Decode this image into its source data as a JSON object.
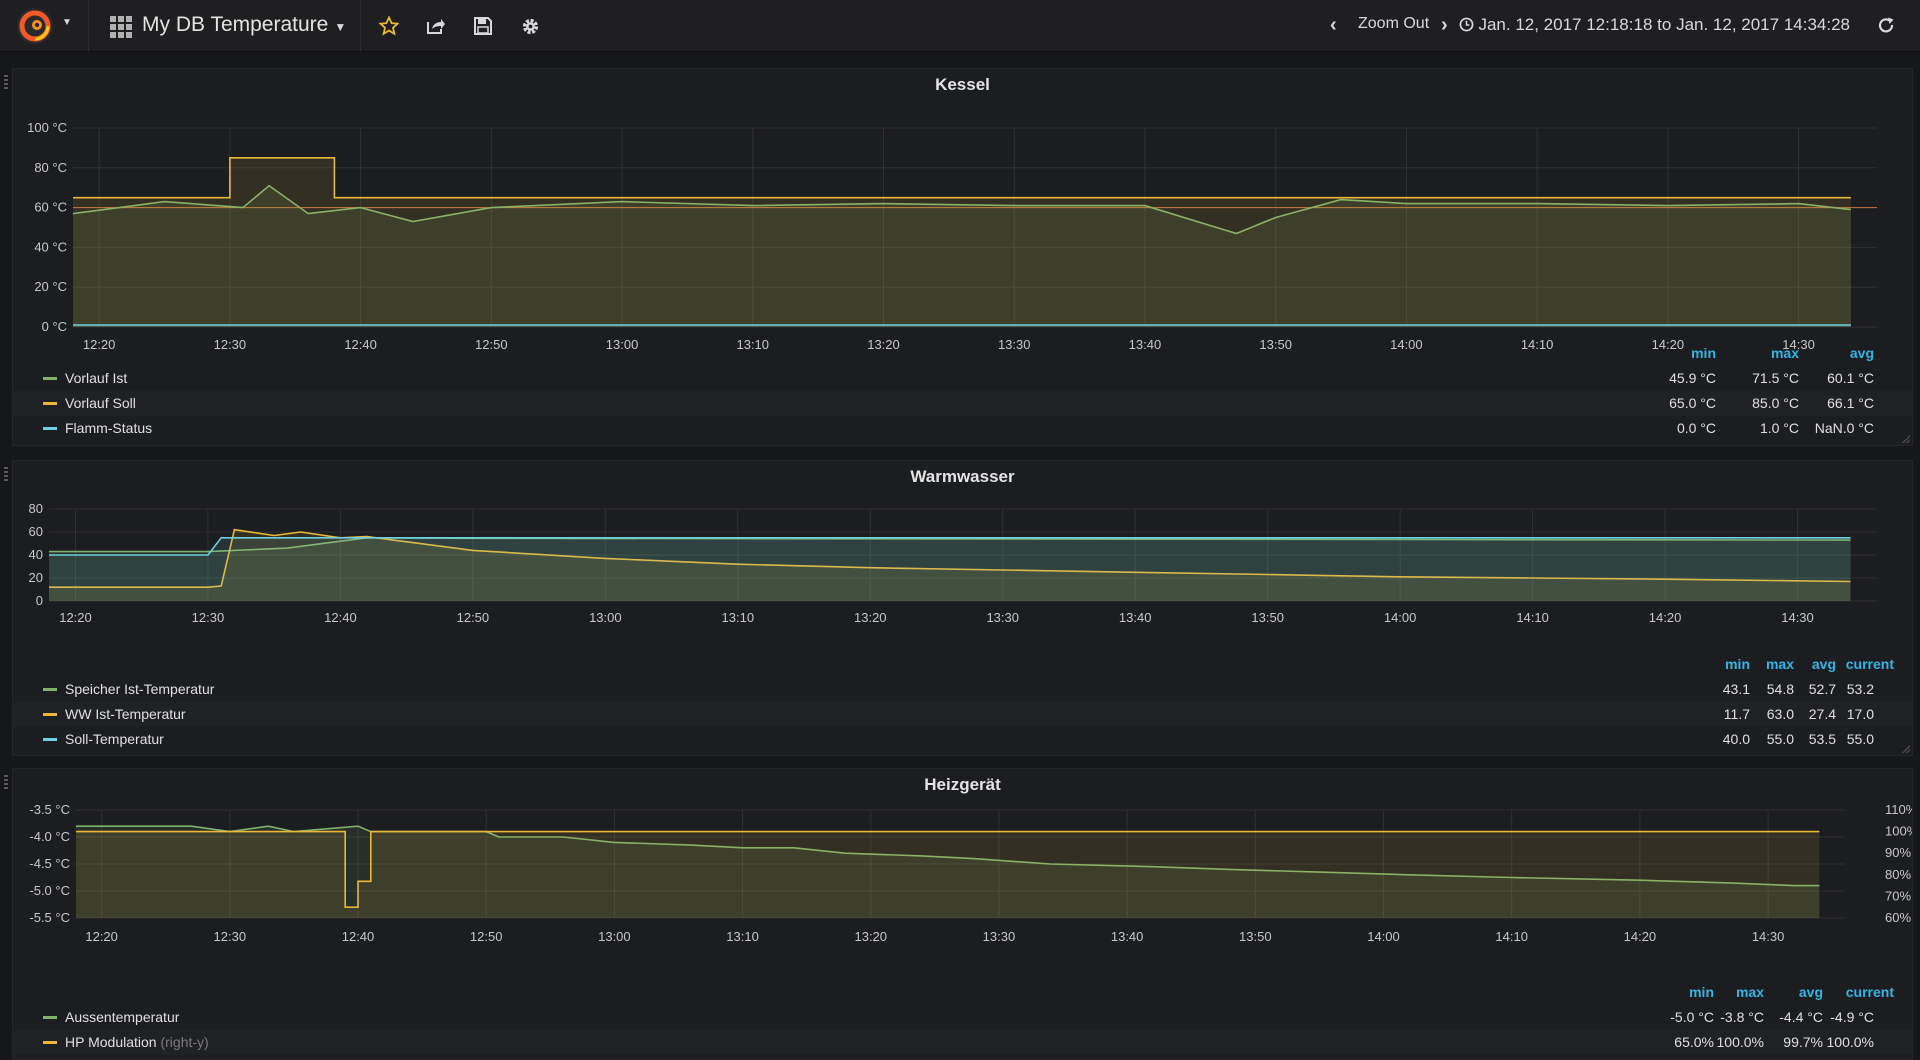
{
  "navbar": {
    "dashboard_title": "My DB Temperature",
    "zoom_out_label": "Zoom Out",
    "time_from": "Jan. 12, 2017 12:18:18",
    "time_to_word": "to",
    "time_to": "Jan. 12, 2017 14:34:28",
    "icons": [
      "grafana-logo-icon",
      "dashboard-grid-icon",
      "star-icon",
      "share-icon",
      "save-icon",
      "gear-icon",
      "chevron-left-icon",
      "chevron-right-icon",
      "clock-icon",
      "refresh-icon"
    ]
  },
  "colors": {
    "green": "#7eb26d",
    "yellow": "#eab839",
    "cyan": "#6ed0e0",
    "orange": "#ef843c",
    "accent_blue": "#33b5e5"
  },
  "panels": [
    {
      "title": "Kessel",
      "legend_headers": [
        "min",
        "max",
        "avg"
      ],
      "legend": [
        {
          "name": "Vorlauf Ist",
          "values": [
            "45.9 °C",
            "71.5 °C",
            "60.1 °C"
          ]
        },
        {
          "name": "Vorlauf Soll",
          "values": [
            "65.0 °C",
            "85.0 °C",
            "66.1 °C"
          ]
        },
        {
          "name": "Flamm-Status",
          "values": [
            "0.0 °C",
            "1.0 °C",
            "NaN.0 °C"
          ]
        }
      ]
    },
    {
      "title": "Warmwasser",
      "legend_headers": [
        "min",
        "max",
        "avg",
        "current"
      ],
      "legend": [
        {
          "name": "Speicher Ist-Temperatur",
          "values": [
            "43.1",
            "54.8",
            "52.7",
            "53.2"
          ]
        },
        {
          "name": "WW Ist-Temperatur",
          "values": [
            "11.7",
            "63.0",
            "27.4",
            "17.0"
          ]
        },
        {
          "name": "Soll-Temperatur",
          "values": [
            "40.0",
            "55.0",
            "53.5",
            "55.0"
          ]
        }
      ]
    },
    {
      "title": "Heizgerät",
      "legend_headers": [
        "min",
        "max",
        "avg",
        "current"
      ],
      "legend": [
        {
          "name": "Aussentemperatur",
          "suffix": "",
          "values": [
            "-5.0 °C",
            "-3.8 °C",
            "-4.4 °C",
            "-4.9 °C"
          ]
        },
        {
          "name": "HP Modulation",
          "suffix": "(right-y)",
          "values": [
            "65.0%",
            "100.0%",
            "99.7%",
            "100.0%"
          ]
        }
      ]
    }
  ],
  "chart_data": [
    {
      "type": "line",
      "title": "Kessel",
      "x_ticks": [
        "12:20",
        "12:30",
        "12:40",
        "12:50",
        "13:00",
        "13:10",
        "13:20",
        "13:30",
        "13:40",
        "13:50",
        "14:00",
        "14:10",
        "14:20",
        "14:30"
      ],
      "y_ticks": [
        "0 °C",
        "20 °C",
        "40 °C",
        "60 °C",
        "80 °C",
        "100 °C"
      ],
      "ylim": [
        0,
        100
      ],
      "xlim_minutes": [
        "12:18",
        "14:34"
      ],
      "threshold": 60,
      "series": [
        {
          "name": "Vorlauf Ist",
          "x": [
            "12:18",
            "12:25",
            "12:31",
            "12:33",
            "12:36",
            "12:40",
            "12:44",
            "12:50",
            "13:00",
            "13:10",
            "13:20",
            "13:30",
            "13:40",
            "13:47",
            "13:50",
            "13:55",
            "14:00",
            "14:10",
            "14:20",
            "14:30",
            "14:34"
          ],
          "values": [
            57,
            63,
            60,
            71,
            57,
            60,
            53,
            60,
            63,
            61,
            62,
            61,
            61,
            47,
            55,
            64,
            62,
            62,
            61,
            62,
            59
          ]
        },
        {
          "name": "Vorlauf Soll",
          "x": [
            "12:18",
            "12:30",
            "12:30",
            "12:38",
            "12:38",
            "14:34"
          ],
          "values": [
            65,
            65,
            85,
            85,
            65,
            65
          ]
        },
        {
          "name": "Flamm-Status",
          "x": [
            "12:18",
            "14:34"
          ],
          "values": [
            1,
            1
          ]
        }
      ]
    },
    {
      "type": "line",
      "title": "Warmwasser",
      "x_ticks": [
        "12:20",
        "12:30",
        "12:40",
        "12:50",
        "13:00",
        "13:10",
        "13:20",
        "13:30",
        "13:40",
        "13:50",
        "14:00",
        "14:10",
        "14:20",
        "14:30"
      ],
      "y_ticks": [
        "0",
        "20",
        "40",
        "60",
        "80"
      ],
      "ylim": [
        0,
        80
      ],
      "series": [
        {
          "name": "Speicher Ist-Temperatur",
          "x": [
            "12:18",
            "12:30",
            "12:32",
            "12:36",
            "12:40",
            "12:42",
            "12:50",
            "14:34"
          ],
          "values": [
            43,
            43,
            44,
            46,
            52,
            55,
            54.5,
            53
          ]
        },
        {
          "name": "WW Ist-Temperatur",
          "x": [
            "12:18",
            "12:30",
            "12:31",
            "12:32",
            "12:35",
            "12:37",
            "12:40",
            "12:42",
            "12:50",
            "13:00",
            "13:10",
            "13:20",
            "13:30",
            "13:40",
            "13:50",
            "14:00",
            "14:10",
            "14:20",
            "14:34"
          ],
          "values": [
            12,
            12,
            13,
            62,
            57,
            60,
            55,
            56,
            44,
            37,
            32,
            29,
            27,
            25,
            23,
            21,
            20,
            19,
            17
          ]
        },
        {
          "name": "Soll-Temperatur",
          "x": [
            "12:18",
            "12:30",
            "12:31",
            "14:34"
          ],
          "values": [
            40,
            40,
            55,
            55
          ]
        }
      ]
    },
    {
      "type": "line",
      "title": "Heizgerät",
      "x_ticks": [
        "12:20",
        "12:30",
        "12:40",
        "12:50",
        "13:00",
        "13:10",
        "13:20",
        "13:30",
        "13:40",
        "13:50",
        "14:00",
        "14:10",
        "14:20",
        "14:30"
      ],
      "y_ticks_left": [
        "-5.5 °C",
        "-5.0 °C",
        "-4.5 °C",
        "-4.0 °C",
        "-3.5 °C"
      ],
      "y_ticks_right": [
        "60%",
        "70%",
        "80%",
        "90%",
        "100%",
        "110%"
      ],
      "ylim_left": [
        -5.5,
        -3.5
      ],
      "ylim_right": [
        60,
        110
      ],
      "series": [
        {
          "name": "Aussentemperatur",
          "axis": "left",
          "x": [
            "12:18",
            "12:27",
            "12:30",
            "12:33",
            "12:35",
            "12:40",
            "12:41",
            "12:50",
            "12:51",
            "12:56",
            "13:00",
            "13:06",
            "13:10",
            "13:14",
            "13:18",
            "13:24",
            "13:28",
            "13:34",
            "13:42",
            "13:48",
            "13:55",
            "14:02",
            "14:10",
            "14:20",
            "14:27",
            "14:32",
            "14:34"
          ],
          "values": [
            -3.8,
            -3.8,
            -3.9,
            -3.8,
            -3.9,
            -3.8,
            -3.9,
            -3.9,
            -4.0,
            -4.0,
            -4.1,
            -4.15,
            -4.2,
            -4.2,
            -4.3,
            -4.35,
            -4.4,
            -4.5,
            -4.55,
            -4.6,
            -4.65,
            -4.7,
            -4.75,
            -4.8,
            -4.85,
            -4.9,
            -4.9
          ]
        },
        {
          "name": "HP Modulation",
          "axis": "right",
          "x": [
            "12:18",
            "12:39",
            "12:39",
            "12:40",
            "12:40",
            "12:41",
            "12:41",
            "14:34"
          ],
          "values": [
            100,
            100,
            65,
            65,
            77,
            77,
            100,
            100
          ]
        }
      ]
    }
  ]
}
